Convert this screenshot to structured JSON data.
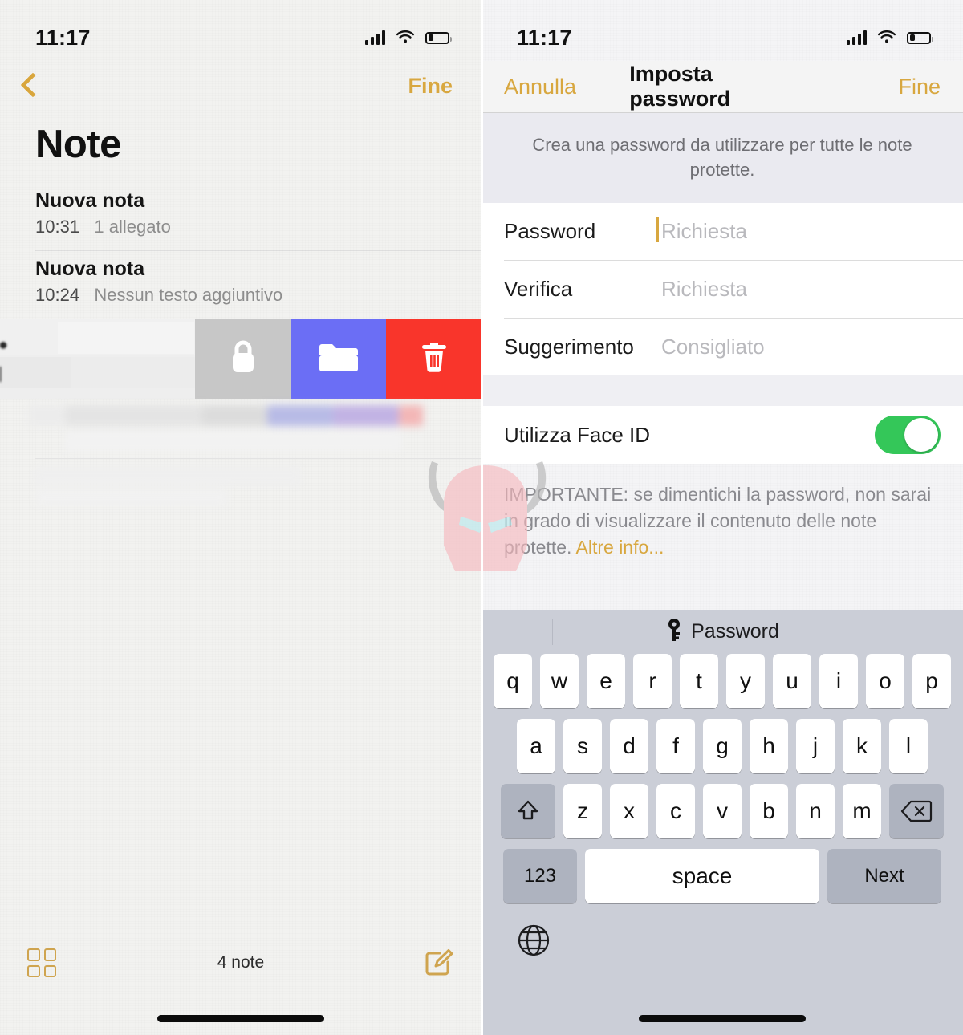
{
  "left_screen": {
    "status_bar": {
      "time": "11:17",
      "signal_icon": "cellular-bars-icon",
      "wifi_icon": "wifi-icon",
      "battery_icon": "battery-low-icon"
    },
    "nav": {
      "back_icon": "chevron-left-icon",
      "done_label": "Fine"
    },
    "title": "Note",
    "notes": [
      {
        "title": "Nuova nota",
        "time": "10:31",
        "preview": "1 allegato"
      },
      {
        "title": "Nuova nota",
        "time": "10:24",
        "preview": "Nessun testo aggiuntivo"
      }
    ],
    "swipe_actions": [
      {
        "name": "lock-action",
        "icon": "lock-icon",
        "color": "#c7c7c7"
      },
      {
        "name": "move-action",
        "icon": "folder-icon",
        "color": "#6b6ef5"
      },
      {
        "name": "delete-action",
        "icon": "trash-icon",
        "color": "#f9352b"
      }
    ],
    "toolbar": {
      "grid_icon": "grid-view-icon",
      "count_label": "4 note",
      "compose_icon": "compose-icon"
    }
  },
  "right_screen": {
    "status_bar": {
      "time": "11:17",
      "signal_icon": "cellular-bars-icon",
      "wifi_icon": "wifi-icon",
      "battery_icon": "battery-low-icon"
    },
    "nav": {
      "cancel_label": "Annulla",
      "title": "Imposta password",
      "done_label": "Fine"
    },
    "description": "Crea una password da utilizzare per tutte le note protette.",
    "fields": [
      {
        "label": "Password",
        "placeholder": "Richiesta",
        "value": "",
        "focused": true
      },
      {
        "label": "Verifica",
        "placeholder": "Richiesta",
        "value": "",
        "focused": false
      },
      {
        "label": "Suggerimento",
        "placeholder": "Consigliato",
        "value": "",
        "focused": false
      }
    ],
    "faceid": {
      "label": "Utilizza Face ID",
      "enabled": true,
      "on_color": "#34c759"
    },
    "important": {
      "text": "IMPORTANTE: se dimentichi la password, non sarai in grado di visualizzare il contenuto delle note protette. ",
      "link_label": "Altre info...",
      "link_color": "#d8a73f"
    },
    "keyboard": {
      "suggestion": {
        "icon": "key-icon",
        "label": "Password"
      },
      "row1": [
        "q",
        "w",
        "e",
        "r",
        "t",
        "y",
        "u",
        "i",
        "o",
        "p"
      ],
      "row2": [
        "a",
        "s",
        "d",
        "f",
        "g",
        "h",
        "j",
        "k",
        "l"
      ],
      "row3_shift_icon": "shift-icon",
      "row3": [
        "z",
        "x",
        "c",
        "v",
        "b",
        "n",
        "m"
      ],
      "row3_delete_icon": "delete-backspace-icon",
      "numbers_key": "123",
      "space_key": "space",
      "return_key": "Next",
      "globe_icon": "globe-icon"
    }
  },
  "watermark": {
    "name": "helmet-watermark",
    "body_color": "#f6b8bd",
    "eye_color": "#b6e8ec",
    "horn_color": "#b3b3b3"
  }
}
